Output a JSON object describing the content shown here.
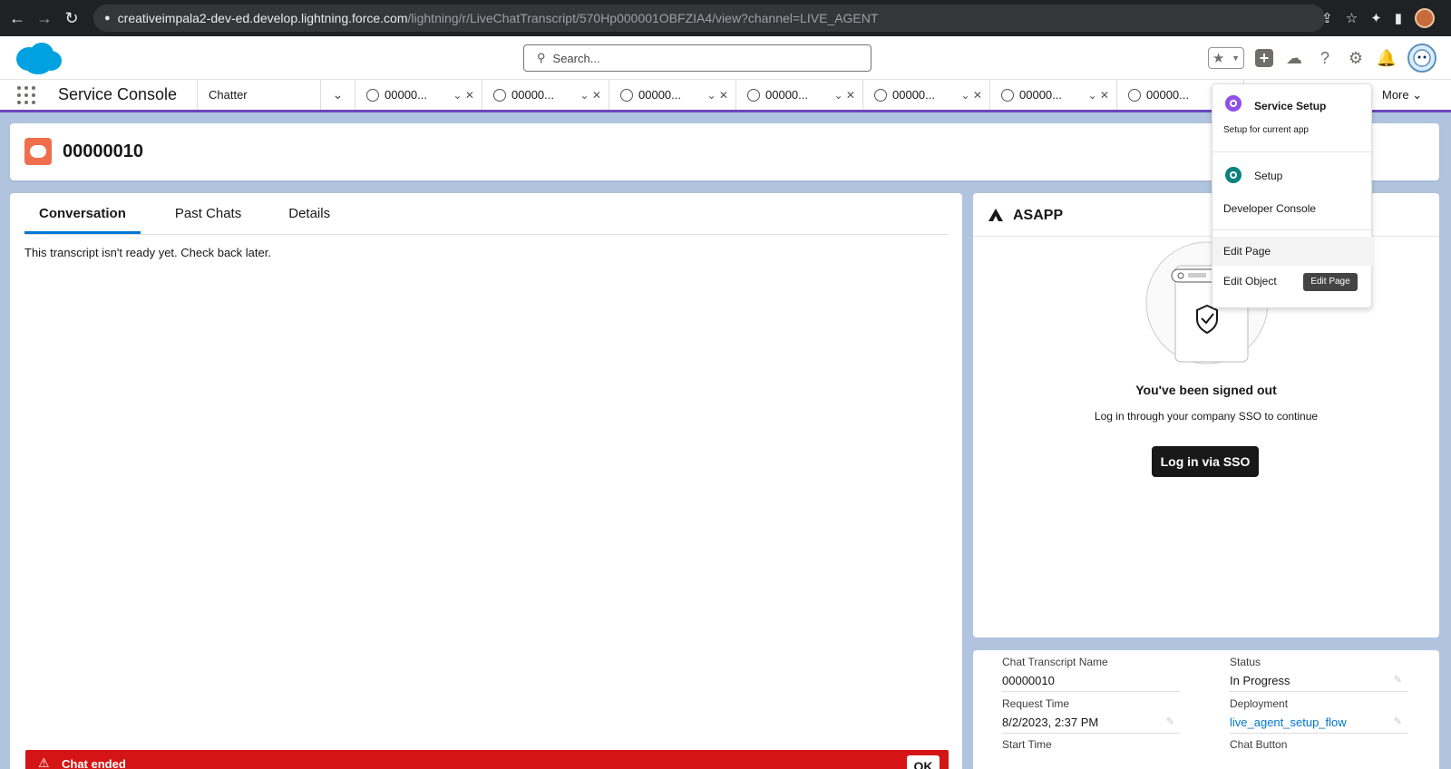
{
  "browser": {
    "url_host": "creativeimpala2-dev-ed.develop.lightning.force.com",
    "url_path": "/lightning/r/LiveChatTranscript/570Hp000001OBFZIA4/view?channel=LIVE_AGENT"
  },
  "header": {
    "search_placeholder": "Search..."
  },
  "navbar": {
    "app_name": "Service Console",
    "nav_item": "Chatter",
    "more_label": "More",
    "tabs": [
      {
        "label": "00000..."
      },
      {
        "label": "00000..."
      },
      {
        "label": "00000..."
      },
      {
        "label": "00000..."
      },
      {
        "label": "00000..."
      },
      {
        "label": "00000..."
      },
      {
        "label": "00000..."
      }
    ]
  },
  "record": {
    "title": "00000010"
  },
  "main": {
    "tabs": [
      "Conversation",
      "Past Chats",
      "Details"
    ],
    "transcript_message": "This transcript isn't ready yet. Check back later.",
    "chat_ended_label": "Chat ended",
    "ok_label": "OK"
  },
  "asapp": {
    "title": "ASAPP",
    "signed_out_heading": "You've been signed out",
    "signed_out_text": "Log in through your company SSO to continue",
    "sso_button": "Log in via SSO"
  },
  "details": {
    "fields": [
      {
        "label": "Chat Transcript Name",
        "value": "00000010"
      },
      {
        "label": "Status",
        "value": "In Progress"
      },
      {
        "label": "Request Time",
        "value": "8/2/2023, 2:37 PM"
      },
      {
        "label": "Deployment",
        "value": "live_agent_setup_flow"
      },
      {
        "label": "Start Time",
        "value": ""
      },
      {
        "label": "Chat Button",
        "value": ""
      }
    ]
  },
  "gear_menu": {
    "service_setup": "Service Setup",
    "service_setup_sub": "Setup for current app",
    "setup": "Setup",
    "developer_console": "Developer Console",
    "edit_page": "Edit Page",
    "edit_object": "Edit Object",
    "tooltip": "Edit Page"
  },
  "colors": {
    "accent_purple": "#6b46c1",
    "brand_blue": "#0176d3",
    "error_red": "#d51515",
    "record_icon": "#ef6e4c"
  }
}
